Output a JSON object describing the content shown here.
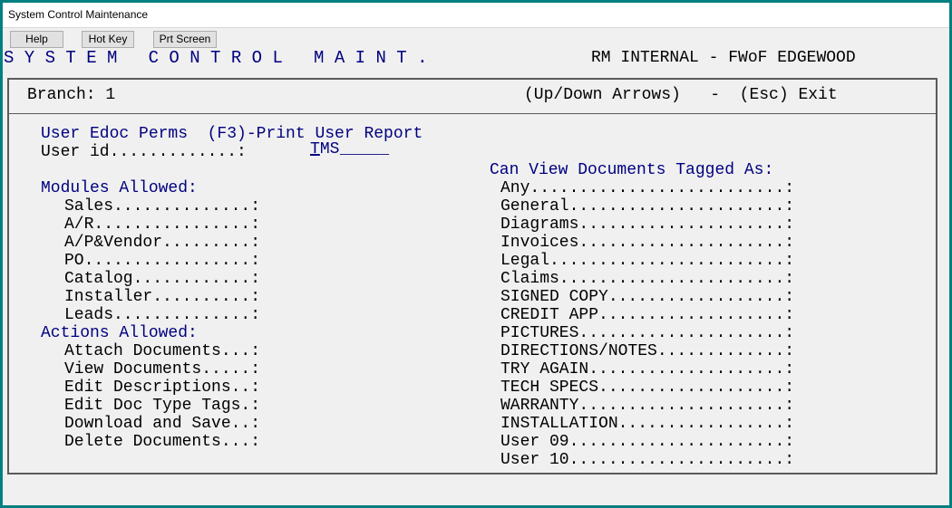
{
  "window": {
    "title": "System Control Maintenance"
  },
  "toolbar": {
    "help": "Help",
    "hotkey": "Hot Key",
    "prtscreen": "Prt Screen"
  },
  "banner": {
    "left": "S Y S T E M   C O N T R O L   M A I N T .",
    "right": "RM INTERNAL - FWoF EDGEWOOD"
  },
  "header": {
    "branch": "Branch: 1",
    "hint": "(Up/Down Arrows)   -  (Esc) Exit"
  },
  "form": {
    "heading": "User Edoc Perms  (F3)-Print User Report",
    "userid_label": "User id.............: ",
    "userid_first": "T",
    "userid_rest": "MS",
    "userid_blank": "_____",
    "modules_heading": "Modules Allowed:",
    "modules": [
      "Sales..............:",
      "A/R................:",
      "A/P&Vendor.........:",
      "PO.................:",
      "Catalog............:",
      "Installer..........:",
      "Leads..............:"
    ],
    "actions_heading": "Actions Allowed:",
    "actions": [
      "Attach Documents...:",
      "View Documents.....:",
      "Edit Descriptions..:",
      "Edit Doc Type Tags.:",
      "Download and Save..:",
      "Delete Documents...:"
    ],
    "tags_heading": "Can View Documents Tagged As:",
    "tags": [
      "Any..........................:",
      "General......................:",
      "Diagrams.....................:",
      "Invoices.....................:",
      "Legal........................:",
      "Claims.......................:",
      "SIGNED COPY..................:",
      "CREDIT APP...................:",
      "PICTURES.....................:",
      "DIRECTIONS/NOTES.............:",
      "TRY AGAIN....................:",
      "TECH SPECS...................:",
      "WARRANTY.....................:",
      "INSTALLATION.................:",
      "User 09......................:",
      "User 10......................:"
    ]
  }
}
